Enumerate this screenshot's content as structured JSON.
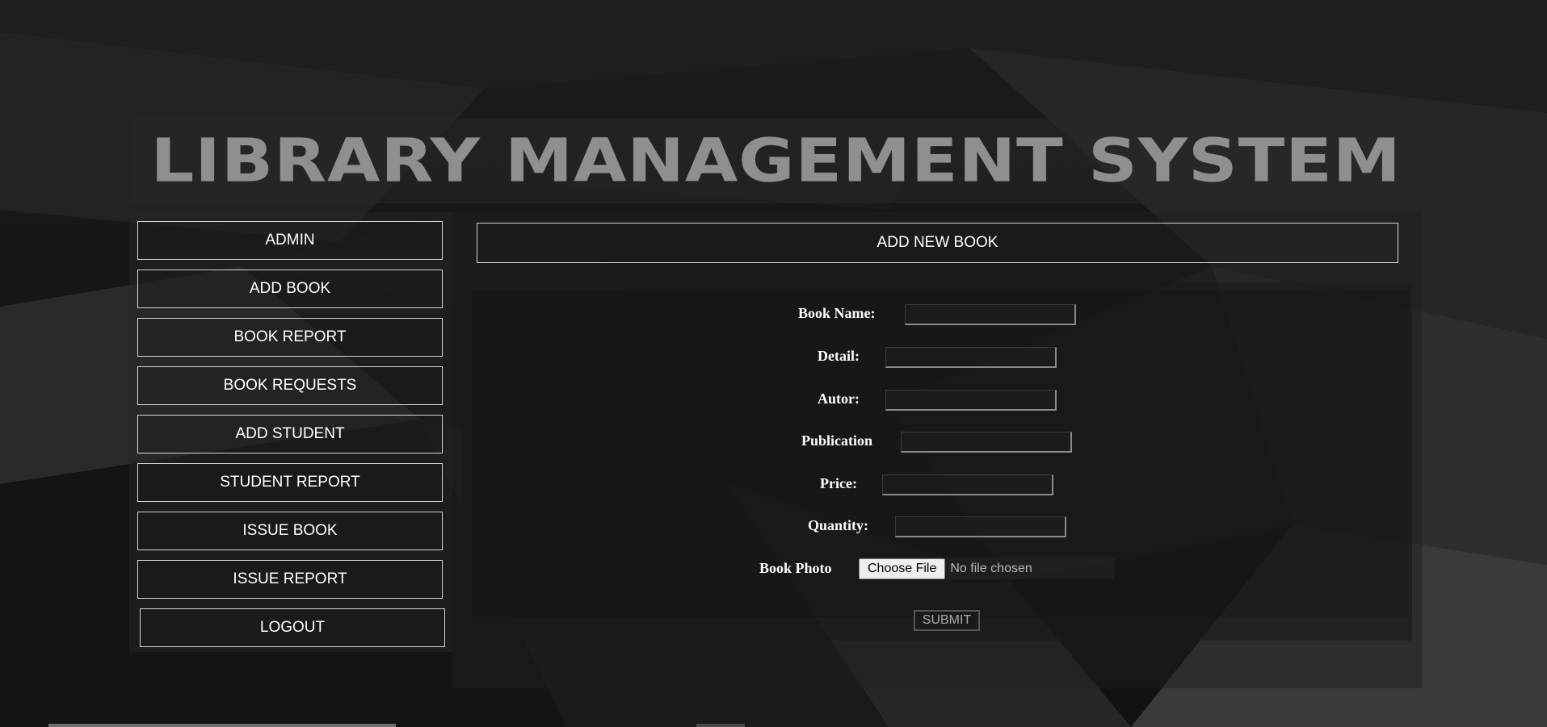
{
  "header": {
    "title": "LIBRARY MANAGEMENT SYSTEM"
  },
  "sidebar": {
    "items": [
      {
        "label": "ADMIN"
      },
      {
        "label": "ADD BOOK"
      },
      {
        "label": "BOOK REPORT"
      },
      {
        "label": "BOOK REQUESTS"
      },
      {
        "label": "ADD STUDENT"
      },
      {
        "label": "STUDENT REPORT"
      },
      {
        "label": "ISSUE BOOK"
      },
      {
        "label": "ISSUE REPORT"
      },
      {
        "label": "LOGOUT"
      }
    ]
  },
  "main": {
    "title": "ADD NEW BOOK",
    "form": {
      "book_name_label": "Book Name:",
      "book_name_value": "",
      "detail_label": "Detail:",
      "detail_value": "",
      "author_label": "Autor:",
      "author_value": "",
      "publication_label": "Publication",
      "publication_value": "",
      "price_label": "Price:",
      "price_value": "",
      "quantity_label": "Quantity:",
      "quantity_value": "",
      "photo_label": "Book Photo",
      "choose_file_label": "Choose File",
      "file_status": "No file chosen",
      "submit_label": "SUBMIT"
    }
  },
  "colors": {
    "background": "#151515",
    "title_text": "#8f8f8f",
    "border": "#d6d6d6",
    "text": "#ffffff"
  }
}
